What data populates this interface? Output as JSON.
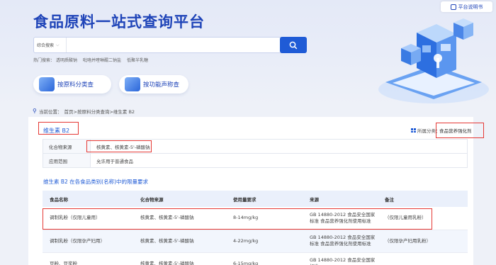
{
  "hero": {
    "title": "食品原料一站式查询平台",
    "platform_button": "平台说明书",
    "search": {
      "select_value": "综合搜索",
      "placeholder": ""
    },
    "hot_label": "热门搜索：",
    "hot_terms": [
      "透明质酸钠",
      "吡咯并喹啉醌二钠盐",
      "低聚半乳糖"
    ],
    "cat_buttons": [
      "按原料分类查",
      "按功能声称查"
    ]
  },
  "breadcrumb": {
    "label": "当前位置：",
    "path": "首页>按原料分类查询>维生素 B2"
  },
  "detail": {
    "title": "维生素 B2",
    "classification_label": "所属分类：",
    "classification_value": "食品营养强化剂",
    "rows": [
      {
        "key": "化合物来源",
        "value": "核黄素、核黄素-5'-磷酸钠"
      },
      {
        "key": "应用范围",
        "value": "允许用于普通食品"
      }
    ]
  },
  "limits": {
    "title": "维生素 B2 在各食品类别(名称)中的限量要求",
    "headers": [
      "食品名称",
      "化合物来源",
      "使用量要求",
      "来源",
      "备注"
    ],
    "rows": [
      {
        "name": "调制乳粉（仅限儿童用）",
        "source": "核黄素、核黄素-5'-磷酸钠",
        "amount": "8-14mg/kg",
        "origin": "GB 14880-2012 食品安全国家标准 食品营养强化剂使用标准",
        "note": "（仅限儿童用乳粉）"
      },
      {
        "name": "调制乳粉（仅限孕产妇用）",
        "source": "核黄素、核黄素-5'-磷酸钠",
        "amount": "4-22mg/kg",
        "origin": "GB 14880-2012 食品安全国家标准 食品营养强化剂使用标准",
        "note": "（仅限孕产妇用乳粉）"
      },
      {
        "name": "豆粉、豆浆粉",
        "source": "核黄素、核黄素-5'-磷酸钠",
        "amount": "6-15mg/kg",
        "origin": "GB 14880-2012 食品安全国家标准",
        "note": ""
      }
    ]
  },
  "colors": {
    "brand_blue": "#1f44b8",
    "accent_blue": "#1f5bd6",
    "highlight_red": "#e53935"
  }
}
